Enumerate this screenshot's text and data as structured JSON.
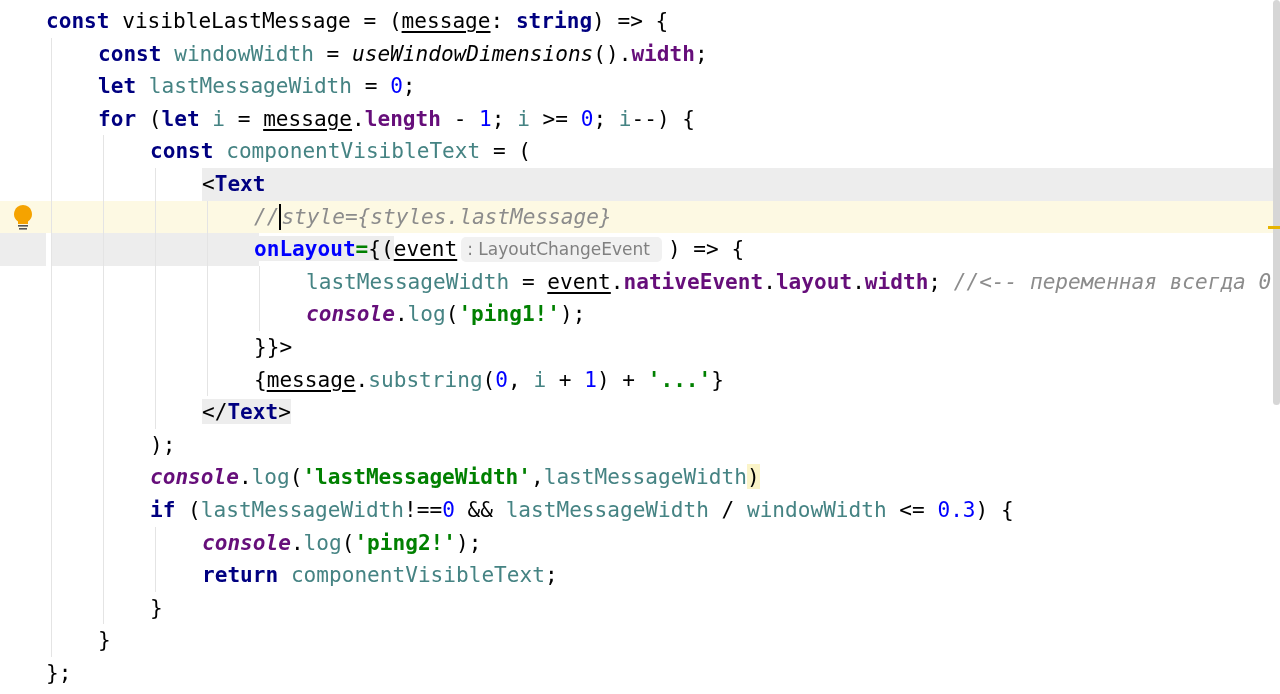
{
  "editor": {
    "lines": [
      {
        "tokens": [
          {
            "kind": "kw",
            "t": "const "
          },
          {
            "kind": "pl",
            "t": "visibleLastMessage = ("
          },
          {
            "kind": "param",
            "t": "message"
          },
          {
            "kind": "pl",
            "t": ": "
          },
          {
            "kind": "kw",
            "t": "string"
          },
          {
            "kind": "pl",
            "t": ") => {"
          }
        ],
        "children": [
          {
            "tokens": [
              {
                "kind": "kw",
                "t": "const "
              },
              {
                "kind": "id",
                "t": "windowWidth"
              },
              {
                "kind": "pl",
                "t": " = "
              },
              {
                "kind": "fn",
                "t": "useWindowDimensions"
              },
              {
                "kind": "pl",
                "t": "()."
              },
              {
                "kind": "prop",
                "t": "width"
              },
              {
                "kind": "pl",
                "t": ";"
              }
            ]
          },
          {
            "tokens": [
              {
                "kind": "kw",
                "t": "let "
              },
              {
                "kind": "id",
                "t": "lastMessageWidth"
              },
              {
                "kind": "pl",
                "t": " = "
              },
              {
                "kind": "num",
                "t": "0"
              },
              {
                "kind": "pl",
                "t": ";"
              }
            ]
          },
          {
            "tokens": [
              {
                "kind": "kw",
                "t": "for "
              },
              {
                "kind": "pl",
                "t": "("
              },
              {
                "kind": "kw",
                "t": "let "
              },
              {
                "kind": "id",
                "t": "i"
              },
              {
                "kind": "pl",
                "t": " = "
              },
              {
                "kind": "param",
                "t": "message"
              },
              {
                "kind": "pl",
                "t": "."
              },
              {
                "kind": "prop",
                "t": "length"
              },
              {
                "kind": "pl",
                "t": " - "
              },
              {
                "kind": "num",
                "t": "1"
              },
              {
                "kind": "pl",
                "t": "; "
              },
              {
                "kind": "id",
                "t": "i"
              },
              {
                "kind": "pl",
                "t": " >= "
              },
              {
                "kind": "num",
                "t": "0"
              },
              {
                "kind": "pl",
                "t": "; "
              },
              {
                "kind": "id",
                "t": "i"
              },
              {
                "kind": "pl",
                "t": "--) {"
              }
            ],
            "children": [
              {
                "tokens": [
                  {
                    "kind": "kw",
                    "t": "const "
                  },
                  {
                    "kind": "id",
                    "t": "componentVisibleText"
                  },
                  {
                    "kind": "pl",
                    "t": " = ("
                  }
                ],
                "children": [
                  {
                    "shaded": true,
                    "tokens": [
                      {
                        "kind": "pl",
                        "t": "<"
                      },
                      {
                        "kind": "tag",
                        "t": "Text"
                      }
                    ],
                    "children": [
                      {
                        "current": true,
                        "bulb": true,
                        "tokens": [
                          {
                            "kind": "cm",
                            "t": "//",
                            "caret": true
                          },
                          {
                            "kind": "cm",
                            "t": "style={styles.lastMessage}"
                          }
                        ]
                      },
                      {
                        "gutter_shaded": true,
                        "tokens": [
                          {
                            "kind": "attr",
                            "t": "onLayout",
                            "shaded": true
                          },
                          {
                            "kind": "eq",
                            "t": "=",
                            "shaded": true
                          },
                          {
                            "kind": "pl",
                            "t": "{(",
                            "shaded": true
                          },
                          {
                            "kind": "param",
                            "t": "event"
                          },
                          {
                            "kind": "hint",
                            "t": ": LayoutChangeEvent"
                          },
                          {
                            "kind": "pl",
                            "t": ") => {"
                          }
                        ],
                        "children": [
                          {
                            "tokens": [
                              {
                                "kind": "id",
                                "t": "lastMessageWidth"
                              },
                              {
                                "kind": "pl",
                                "t": " = "
                              },
                              {
                                "kind": "param",
                                "t": "event"
                              },
                              {
                                "kind": "pl",
                                "t": "."
                              },
                              {
                                "kind": "prop",
                                "t": "nativeEvent"
                              },
                              {
                                "kind": "pl",
                                "t": "."
                              },
                              {
                                "kind": "prop",
                                "t": "layout"
                              },
                              {
                                "kind": "pl",
                                "t": "."
                              },
                              {
                                "kind": "prop",
                                "t": "width"
                              },
                              {
                                "kind": "pl",
                                "t": "; "
                              },
                              {
                                "kind": "cm",
                                "t": "//<-- переменная всегда 0"
                              }
                            ]
                          },
                          {
                            "tokens": [
                              {
                                "kind": "cons",
                                "t": "console"
                              },
                              {
                                "kind": "pl",
                                "t": "."
                              },
                              {
                                "kind": "meth",
                                "t": "log"
                              },
                              {
                                "kind": "pl",
                                "t": "("
                              },
                              {
                                "kind": "str",
                                "t": "'ping1!'"
                              },
                              {
                                "kind": "pl",
                                "t": ");"
                              }
                            ]
                          }
                        ]
                      },
                      {
                        "tokens": [
                          {
                            "kind": "pl",
                            "t": "}}>"
                          }
                        ]
                      },
                      {
                        "tokens": [
                          {
                            "kind": "pl",
                            "t": "{"
                          },
                          {
                            "kind": "param",
                            "t": "message"
                          },
                          {
                            "kind": "pl",
                            "t": "."
                          },
                          {
                            "kind": "meth",
                            "t": "substring"
                          },
                          {
                            "kind": "pl",
                            "t": "("
                          },
                          {
                            "kind": "num",
                            "t": "0"
                          },
                          {
                            "kind": "pl",
                            "t": ", "
                          },
                          {
                            "kind": "id",
                            "t": "i"
                          },
                          {
                            "kind": "pl",
                            "t": " + "
                          },
                          {
                            "kind": "num",
                            "t": "1"
                          },
                          {
                            "kind": "pl",
                            "t": ") + "
                          },
                          {
                            "kind": "str",
                            "t": "'...'"
                          },
                          {
                            "kind": "pl",
                            "t": "}"
                          }
                        ]
                      }
                    ]
                  },
                  {
                    "tokens": [
                      {
                        "kind": "pl",
                        "t": "</",
                        "shaded": true
                      },
                      {
                        "kind": "tag",
                        "t": "Text",
                        "shaded": true
                      },
                      {
                        "kind": "pl",
                        "t": ">",
                        "shaded": true
                      }
                    ]
                  }
                ]
              },
              {
                "tokens": [
                  {
                    "kind": "pl",
                    "t": ");"
                  }
                ]
              },
              {
                "tokens": [
                  {
                    "kind": "cons",
                    "t": "console"
                  },
                  {
                    "kind": "pl",
                    "t": "."
                  },
                  {
                    "kind": "meth",
                    "t": "log"
                  },
                  {
                    "kind": "pl",
                    "t": "("
                  },
                  {
                    "kind": "str",
                    "t": "'lastMessageWidth'"
                  },
                  {
                    "kind": "pl",
                    "t": ","
                  },
                  {
                    "kind": "id",
                    "t": "lastMessageWidth"
                  },
                  {
                    "kind": "pl",
                    "t": ")",
                    "brace_matched": true
                  }
                ]
              },
              {
                "tokens": [
                  {
                    "kind": "kw",
                    "t": "if "
                  },
                  {
                    "kind": "pl",
                    "t": "("
                  },
                  {
                    "kind": "id",
                    "t": "lastMessageWidth"
                  },
                  {
                    "kind": "pl",
                    "t": "!=="
                  },
                  {
                    "kind": "num",
                    "t": "0"
                  },
                  {
                    "kind": "pl",
                    "t": " && "
                  },
                  {
                    "kind": "id",
                    "t": "lastMessageWidth"
                  },
                  {
                    "kind": "pl",
                    "t": " / "
                  },
                  {
                    "kind": "id",
                    "t": "windowWidth"
                  },
                  {
                    "kind": "pl",
                    "t": " <= "
                  },
                  {
                    "kind": "num",
                    "t": "0.3"
                  },
                  {
                    "kind": "pl",
                    "t": ") {"
                  }
                ],
                "children": [
                  {
                    "tokens": [
                      {
                        "kind": "cons",
                        "t": "console"
                      },
                      {
                        "kind": "pl",
                        "t": "."
                      },
                      {
                        "kind": "meth",
                        "t": "log"
                      },
                      {
                        "kind": "pl",
                        "t": "("
                      },
                      {
                        "kind": "str",
                        "t": "'ping2!'"
                      },
                      {
                        "kind": "pl",
                        "t": ");"
                      }
                    ]
                  },
                  {
                    "tokens": [
                      {
                        "kind": "kw",
                        "t": "return "
                      },
                      {
                        "kind": "id",
                        "t": "componentVisibleText"
                      },
                      {
                        "kind": "pl",
                        "t": ";"
                      }
                    ]
                  }
                ]
              },
              {
                "tokens": [
                  {
                    "kind": "pl",
                    "t": "}"
                  }
                ]
              }
            ]
          },
          {
            "tokens": [
              {
                "kind": "pl",
                "t": "}"
              }
            ]
          }
        ]
      },
      {
        "tokens": [
          {
            "kind": "pl",
            "t": "};"
          }
        ]
      }
    ]
  }
}
